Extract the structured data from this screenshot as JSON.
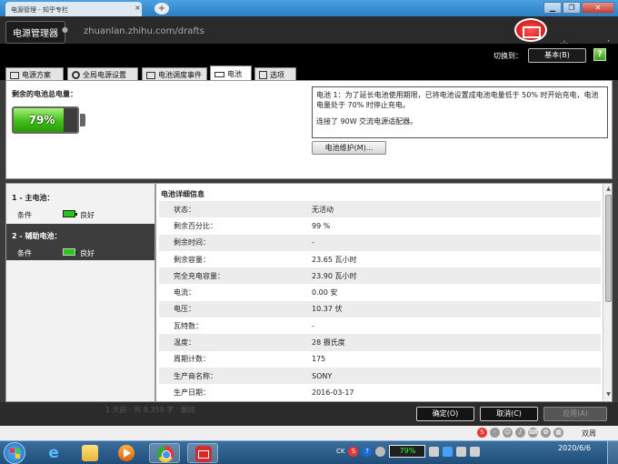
{
  "browser": {
    "tab_label": "电源管理 - 知乎专栏",
    "tab_close": "×",
    "new_tab": "+",
    "window_controls": [
      "▁",
      "❐",
      "✕"
    ],
    "url": "zhuanlan.zhihu.com/drafts",
    "star": "☆",
    "menu": "⋮",
    "status_text": "1 天前 · 共 8,359 字 · 删除",
    "status_right": "双周"
  },
  "app": {
    "title": "电源管理器",
    "switch_label": "切换到：",
    "basic_button": "基本(B)",
    "help": "?",
    "tabs": [
      {
        "label": "电源方案",
        "icon": "doc-icon"
      },
      {
        "label": "全局电源设置",
        "icon": "gear-icon"
      },
      {
        "label": "电池调度事件",
        "icon": "doc-icon"
      },
      {
        "label": "电池",
        "icon": "battery-icon"
      },
      {
        "label": "选项",
        "icon": "check-icon"
      }
    ],
    "active_tab": 3
  },
  "battery_summary": {
    "remaining_label": "剩余的电池总电量：",
    "percent_text": "79%",
    "percent": 79,
    "info_line1": "电池 1：为了延长电池使用期限，已将电池设置成电池电量低于 50% 时开始充电，电池电量处于 70% 时停止充电。",
    "info_line2": "连接了 90W 交流电源适配器。",
    "maintenance_button": "电池维护(M)..."
  },
  "battery_list": [
    {
      "title": "1 - 主电池：",
      "condition_label": "条件",
      "condition_value": "良好",
      "selected": false
    },
    {
      "title": "2 - 辅助电池：",
      "condition_label": "条件",
      "condition_value": "良好",
      "selected": true
    }
  ],
  "details": {
    "title": "电池详细信息",
    "rows": [
      {
        "key": "状态：",
        "value": "无活动"
      },
      {
        "key": "剩余百分比：",
        "value": "99 %"
      },
      {
        "key": "剩余时间：",
        "value": "-"
      },
      {
        "key": "剩余容量：",
        "value": "23.65 瓦小时"
      },
      {
        "key": "完全充电容量：",
        "value": "23.90 瓦小时"
      },
      {
        "key": "电流：",
        "value": "0.00 安"
      },
      {
        "key": "电压：",
        "value": "10.37 伏"
      },
      {
        "key": "瓦特数：",
        "value": "-"
      },
      {
        "key": "温度：",
        "value": "28 摄氏度"
      },
      {
        "key": "周期计数：",
        "value": "175"
      },
      {
        "key": "生产商名称：",
        "value": "SONY"
      },
      {
        "key": "生产日期：",
        "value": "2016-03-17"
      }
    ]
  },
  "dialog_buttons": {
    "ok": "确定(O)",
    "cancel": "取消(C)",
    "apply": "应用(A)"
  },
  "taskbar": {
    "tray_lang": "CK",
    "tray_battery": "79%",
    "clock_date": "2020/6/6"
  }
}
